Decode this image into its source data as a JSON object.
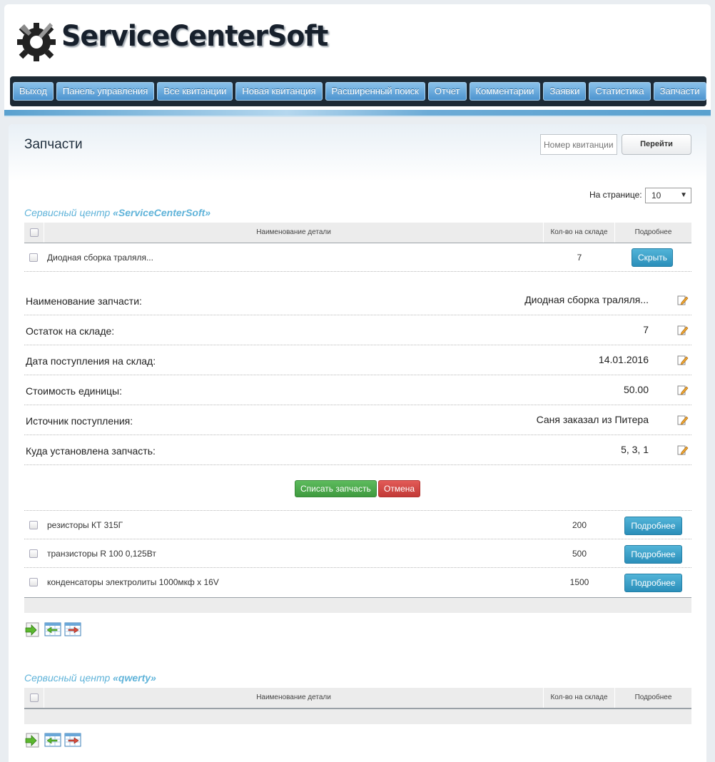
{
  "app": {
    "logo_text": "ServiceCenterSoft"
  },
  "nav": {
    "items": [
      "Выход",
      "Панель управления",
      "Все квитанции",
      "Новая квитанция",
      "Расширенный поиск",
      "Отчет",
      "Комментарии",
      "Заявки",
      "Статистика",
      "Запчасти"
    ]
  },
  "page": {
    "title": "Запчасти",
    "search_placeholder": "Номер квитанции",
    "go_label": "Перейти",
    "per_page_label": "На странице:",
    "per_page_value": "10"
  },
  "table_headers": {
    "name": "Наименование детали",
    "qty": "Кол-во на складе",
    "more": "Подробнее"
  },
  "center1": {
    "prefix": "Сервисный центр ",
    "name": "«ServiceCenterSoft»",
    "expanded_row": {
      "name": "Диодная сборка траляля...",
      "qty": "7",
      "button": "Скрыть"
    },
    "details": [
      {
        "label": "Наименование запчасти:",
        "value": "Диодная сборка траляля..."
      },
      {
        "label": "Остаток на складе:",
        "value": "7"
      },
      {
        "label": "Дата поступления на склад:",
        "value": "14.01.2016"
      },
      {
        "label": "Стоимость единицы:",
        "value": "50.00"
      },
      {
        "label": "Источник поступления:",
        "value": "Саня заказал из Питера"
      },
      {
        "label": "Куда установлена запчасть:",
        "value": "5, 3, 1"
      }
    ],
    "writeoff_label": "Списать запчасть",
    "cancel_label": "Отмена",
    "rows": [
      {
        "name": "резисторы КТ 315Г",
        "qty": "200",
        "button": "Подробнее"
      },
      {
        "name": "транзисторы R 100 0,125Вт",
        "qty": "500",
        "button": "Подробнее"
      },
      {
        "name": "конденсаторы электролиты 1000мкф x 16V",
        "qty": "1500",
        "button": "Подробнее"
      }
    ]
  },
  "center2": {
    "prefix": "Сервисный центр ",
    "name": "«qwerty»"
  },
  "colors": {
    "accent": "#5fb3d9",
    "nav_bg": "#1d2a35",
    "green": "#4cae4c",
    "red": "#d43f3a"
  }
}
